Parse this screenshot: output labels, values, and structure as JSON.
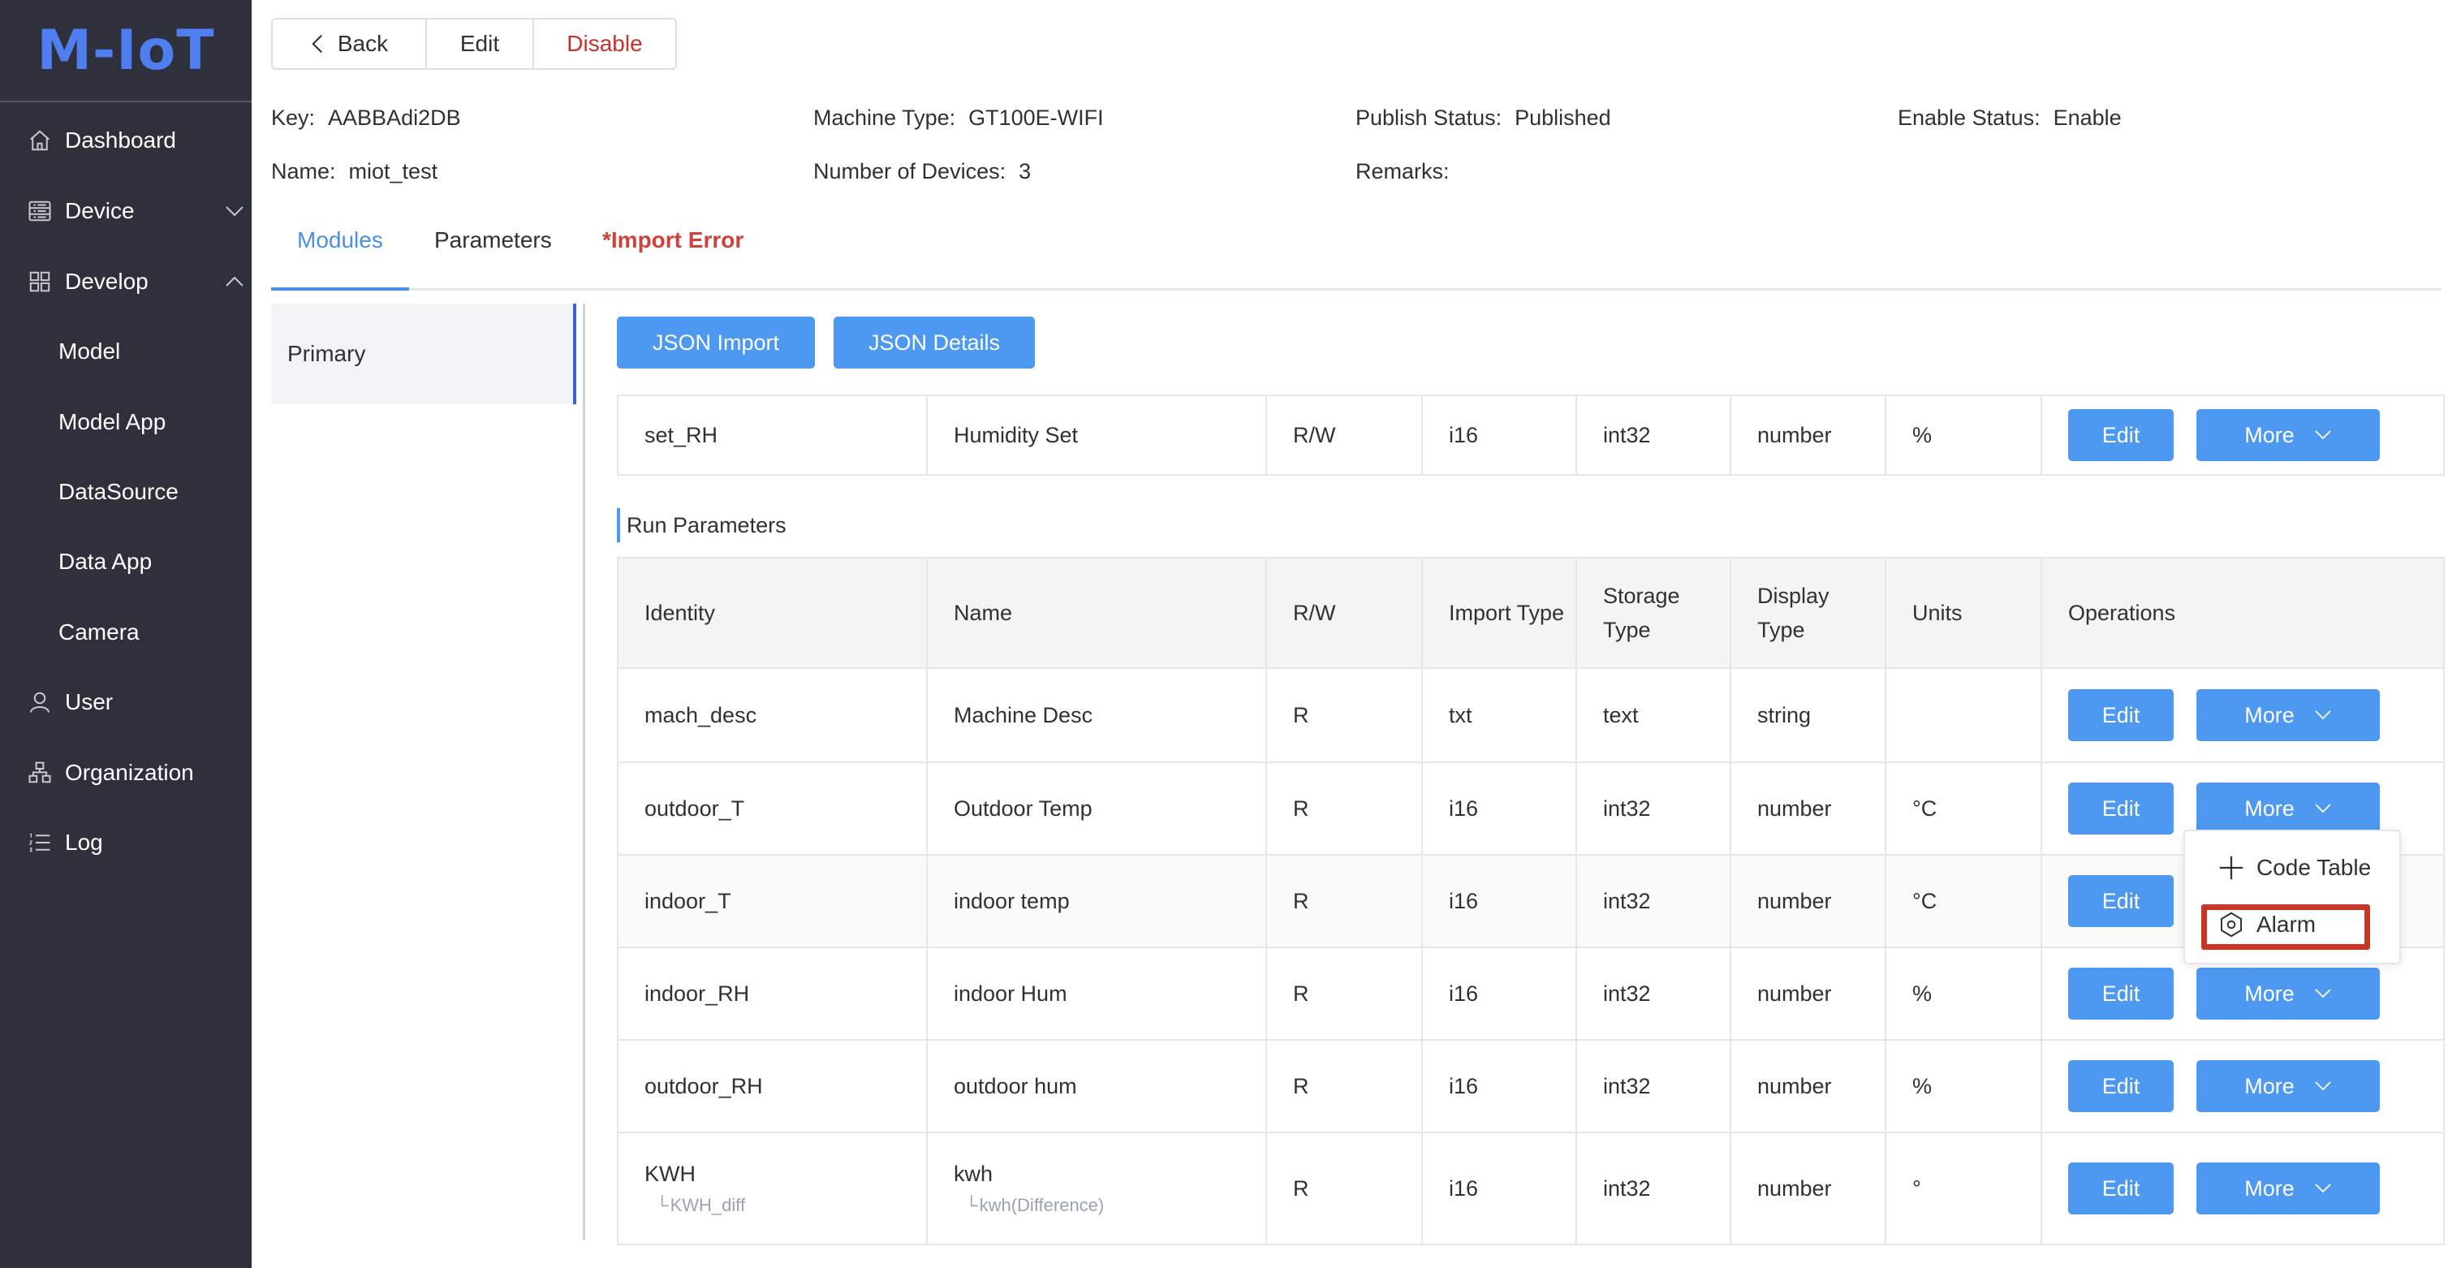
{
  "app": {
    "logo": "M-IoT"
  },
  "sidebar": {
    "items": [
      {
        "label": "Dashboard",
        "icon": "home-icon"
      },
      {
        "label": "Device",
        "icon": "list-box-icon",
        "chevron": "down"
      },
      {
        "label": "Develop",
        "icon": "grid-icon",
        "chevron": "up"
      },
      {
        "label": "Model"
      },
      {
        "label": "Model App"
      },
      {
        "label": "DataSource"
      },
      {
        "label": "Data App"
      },
      {
        "label": "Camera"
      },
      {
        "label": "User",
        "icon": "user-icon"
      },
      {
        "label": "Organization",
        "icon": "org-chart-icon"
      },
      {
        "label": "Log",
        "icon": "ordered-list-icon"
      }
    ]
  },
  "toolbar": {
    "back_label": "Back",
    "edit_label": "Edit",
    "disable_label": "Disable"
  },
  "info": {
    "key_label": "Key:",
    "key_value": "AABBAdi2DB",
    "machine_type_label": "Machine Type:",
    "machine_type_value": "GT100E-WIFI",
    "publish_status_label": "Publish Status:",
    "publish_status_value": "Published",
    "enable_status_label": "Enable Status:",
    "enable_status_value": "Enable",
    "name_label": "Name:",
    "name_value": "miot_test",
    "devices_label": "Number of Devices:",
    "devices_value": "3",
    "remarks_label": "Remarks:",
    "remarks_value": ""
  },
  "tabs": [
    {
      "label": "Modules",
      "active": true
    },
    {
      "label": "Parameters"
    },
    {
      "label": "*Import Error",
      "error": true
    }
  ],
  "modules": {
    "items": [
      "Primary"
    ]
  },
  "actions": {
    "json_import": "JSON Import",
    "json_details": "JSON Details"
  },
  "set_params_table": {
    "rows": [
      {
        "identity": "set_RH",
        "name": "Humidity Set",
        "rw": "R/W",
        "import_type": "i16",
        "storage_type": "int32",
        "display_type": "number",
        "units": "%"
      }
    ]
  },
  "run_params": {
    "title": "Run Parameters",
    "headers": {
      "identity": "Identity",
      "name": "Name",
      "rw": "R/W",
      "import_type": "Import Type",
      "storage_type": "Storage Type",
      "display_type": "Display Type",
      "units": "Units",
      "operations": "Operations"
    },
    "edit_label": "Edit",
    "more_label": "More",
    "rows": [
      {
        "identity": "mach_desc",
        "name": "Machine Desc",
        "rw": "R",
        "import_type": "txt",
        "storage_type": "text",
        "display_type": "string",
        "units": ""
      },
      {
        "identity": "outdoor_T",
        "name": "Outdoor Temp",
        "rw": "R",
        "import_type": "i16",
        "storage_type": "int32",
        "display_type": "number",
        "units": "°C"
      },
      {
        "identity": "indoor_T",
        "name": "indoor temp",
        "rw": "R",
        "import_type": "i16",
        "storage_type": "int32",
        "display_type": "number",
        "units": "°C"
      },
      {
        "identity": "indoor_RH",
        "name": "indoor Hum",
        "rw": "R",
        "import_type": "i16",
        "storage_type": "int32",
        "display_type": "number",
        "units": "%"
      },
      {
        "identity": "outdoor_RH",
        "name": "outdoor hum",
        "rw": "R",
        "import_type": "i16",
        "storage_type": "int32",
        "display_type": "number",
        "units": "%"
      },
      {
        "identity": "KWH",
        "identity_sub": "KWH_diff",
        "name": "kwh",
        "name_sub": "kwh(Difference)",
        "rw": "R",
        "import_type": "i16",
        "storage_type": "int32",
        "display_type": "number",
        "units": "°"
      }
    ]
  },
  "more_dropdown": {
    "items": [
      {
        "label": "Code Table",
        "icon": "plus-icon"
      },
      {
        "label": "Alarm",
        "icon": "alarm-hexagon-icon",
        "highlighted": true
      }
    ]
  },
  "colors": {
    "primary": "#4d98f0",
    "danger": "#c9312f",
    "sidebar_bg": "#2e303b",
    "logo": "#4f7ef0",
    "highlight_box": "#c93625"
  }
}
